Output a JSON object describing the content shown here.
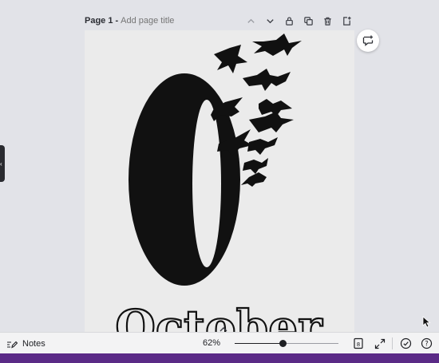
{
  "page": {
    "label": "Page 1",
    "separator": "-",
    "title_placeholder": "Add page title"
  },
  "page_actions": [
    {
      "name": "move-up",
      "icon": "chevron-up-icon"
    },
    {
      "name": "move-down",
      "icon": "chevron-down-icon"
    },
    {
      "name": "lock",
      "icon": "lock-icon"
    },
    {
      "name": "duplicate",
      "icon": "duplicate-icon"
    },
    {
      "name": "delete",
      "icon": "trash-icon"
    },
    {
      "name": "add-page",
      "icon": "add-page-icon"
    }
  ],
  "design": {
    "big_glyph": "O",
    "word": "October",
    "ink_color": "#111111",
    "background_color": "#ebebeb"
  },
  "footer": {
    "notes_label": "Notes",
    "zoom_label": "62%",
    "zoom_level": 0.46
  },
  "colors": {
    "app_bg": "#e2e3e8",
    "accent_bar": "#5a2a86"
  }
}
